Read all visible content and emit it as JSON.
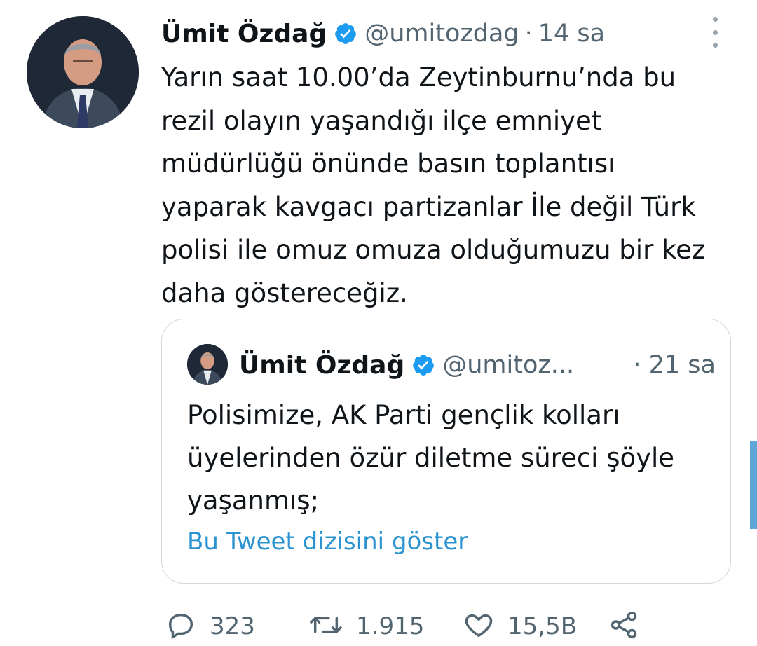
{
  "tweet": {
    "author_name": "Ümit Özdağ",
    "handle": "@umitozdag",
    "separator": "·",
    "time": "14 sa",
    "text": "Yarın saat 10.00’da Zeytinburnu’nda bu\nrezil olayın yaşandığı ilçe emniyet\nmüdürlüğü önünde basın toplantısı\nyaparak kavgacı partizanlar İle değil Türk\npolisi ile omuz omuza olduğumuzu bir kez\ndaha göstereceğiz."
  },
  "quoted_tweet": {
    "author_name": "Ümit Özdağ",
    "handle": "@umitoz...",
    "time_label": "· 21 sa",
    "text": "Polisimize, AK Parti gençlik kolları\nüyelerinden özür diletme süreci şöyle\nyaşanmış;",
    "show_thread_link": "Bu Tweet dizisini göster"
  },
  "actions": {
    "reply_count": "323",
    "retweet_count": "1.915",
    "like_count": "15,5B"
  },
  "colors": {
    "verified": "#1d9bf0",
    "secondary_text": "#536471",
    "link": "#2b93d2",
    "border": "#cfd9de"
  },
  "icons": [
    "verified-badge-icon",
    "more-options-icon",
    "reply-icon",
    "retweet-icon",
    "like-icon",
    "share-icon"
  ]
}
